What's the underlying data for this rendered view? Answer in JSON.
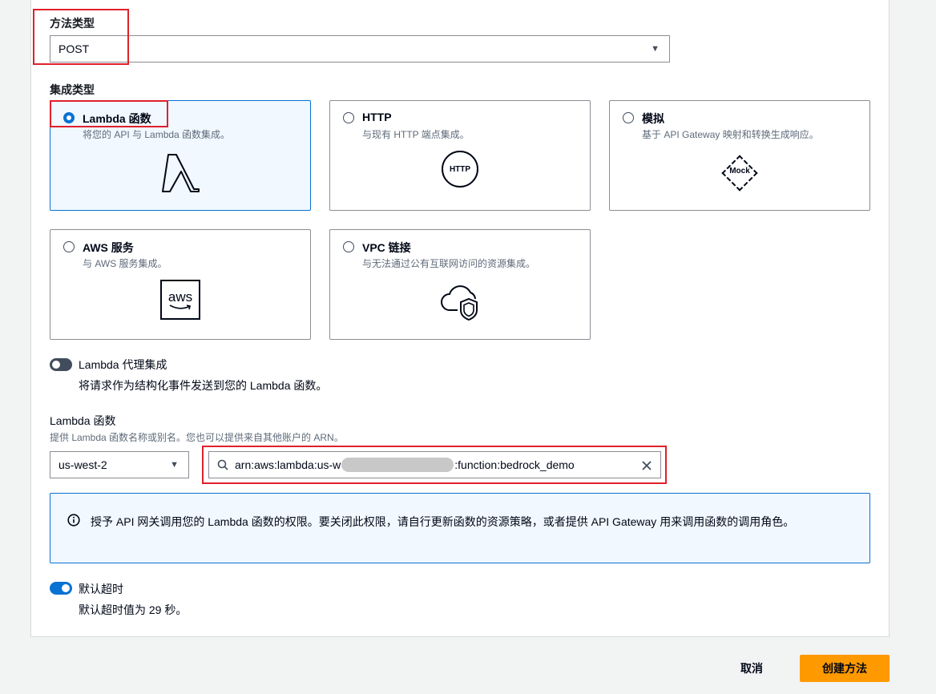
{
  "method": {
    "label": "方法类型",
    "selected": "POST"
  },
  "integration": {
    "label": "集成类型",
    "options": [
      {
        "title": "Lambda 函数",
        "desc": "将您的 API 与 Lambda 函数集成。",
        "icon": "lambda-icon",
        "selected": true
      },
      {
        "title": "HTTP",
        "desc": "与现有 HTTP 端点集成。",
        "icon": "http-icon",
        "icon_text": "HTTP",
        "selected": false
      },
      {
        "title": "模拟",
        "desc": "基于 API Gateway 映射和转换生成响应。",
        "icon": "mock-icon",
        "icon_text": "Mock",
        "selected": false
      },
      {
        "title": "AWS 服务",
        "desc": "与 AWS 服务集成。",
        "icon": "aws-icon",
        "icon_text": "aws",
        "selected": false
      },
      {
        "title": "VPC 链接",
        "desc": "与无法通过公有互联网访问的资源集成。",
        "icon": "cloud-shield-icon",
        "selected": false
      }
    ]
  },
  "proxy": {
    "label": "Lambda 代理集成",
    "desc": "将请求作为结构化事件发送到您的 Lambda 函数。",
    "enabled": false
  },
  "lambda_function": {
    "label": "Lambda 函数",
    "desc": "提供 Lambda 函数名称或别名。您也可以提供来自其他账户的 ARN。",
    "region": "us-west-2",
    "arn_prefix": "arn:aws:lambda:us-w",
    "arn_suffix": ":function:bedrock_demo"
  },
  "info_alert": {
    "text": "授予 API 网关调用您的 Lambda 函数的权限。要关闭此权限，请自行更新函数的资源策略，或者提供 API Gateway 用来调用函数的调用角色。"
  },
  "timeout": {
    "label": "默认超时",
    "desc": "默认超时值为 29 秒。",
    "enabled": true
  },
  "footer": {
    "cancel": "取消",
    "create": "创建方法"
  },
  "colors": {
    "accent": "#0972d3",
    "primary_button": "#ff9900",
    "highlight": "#e0202b"
  }
}
